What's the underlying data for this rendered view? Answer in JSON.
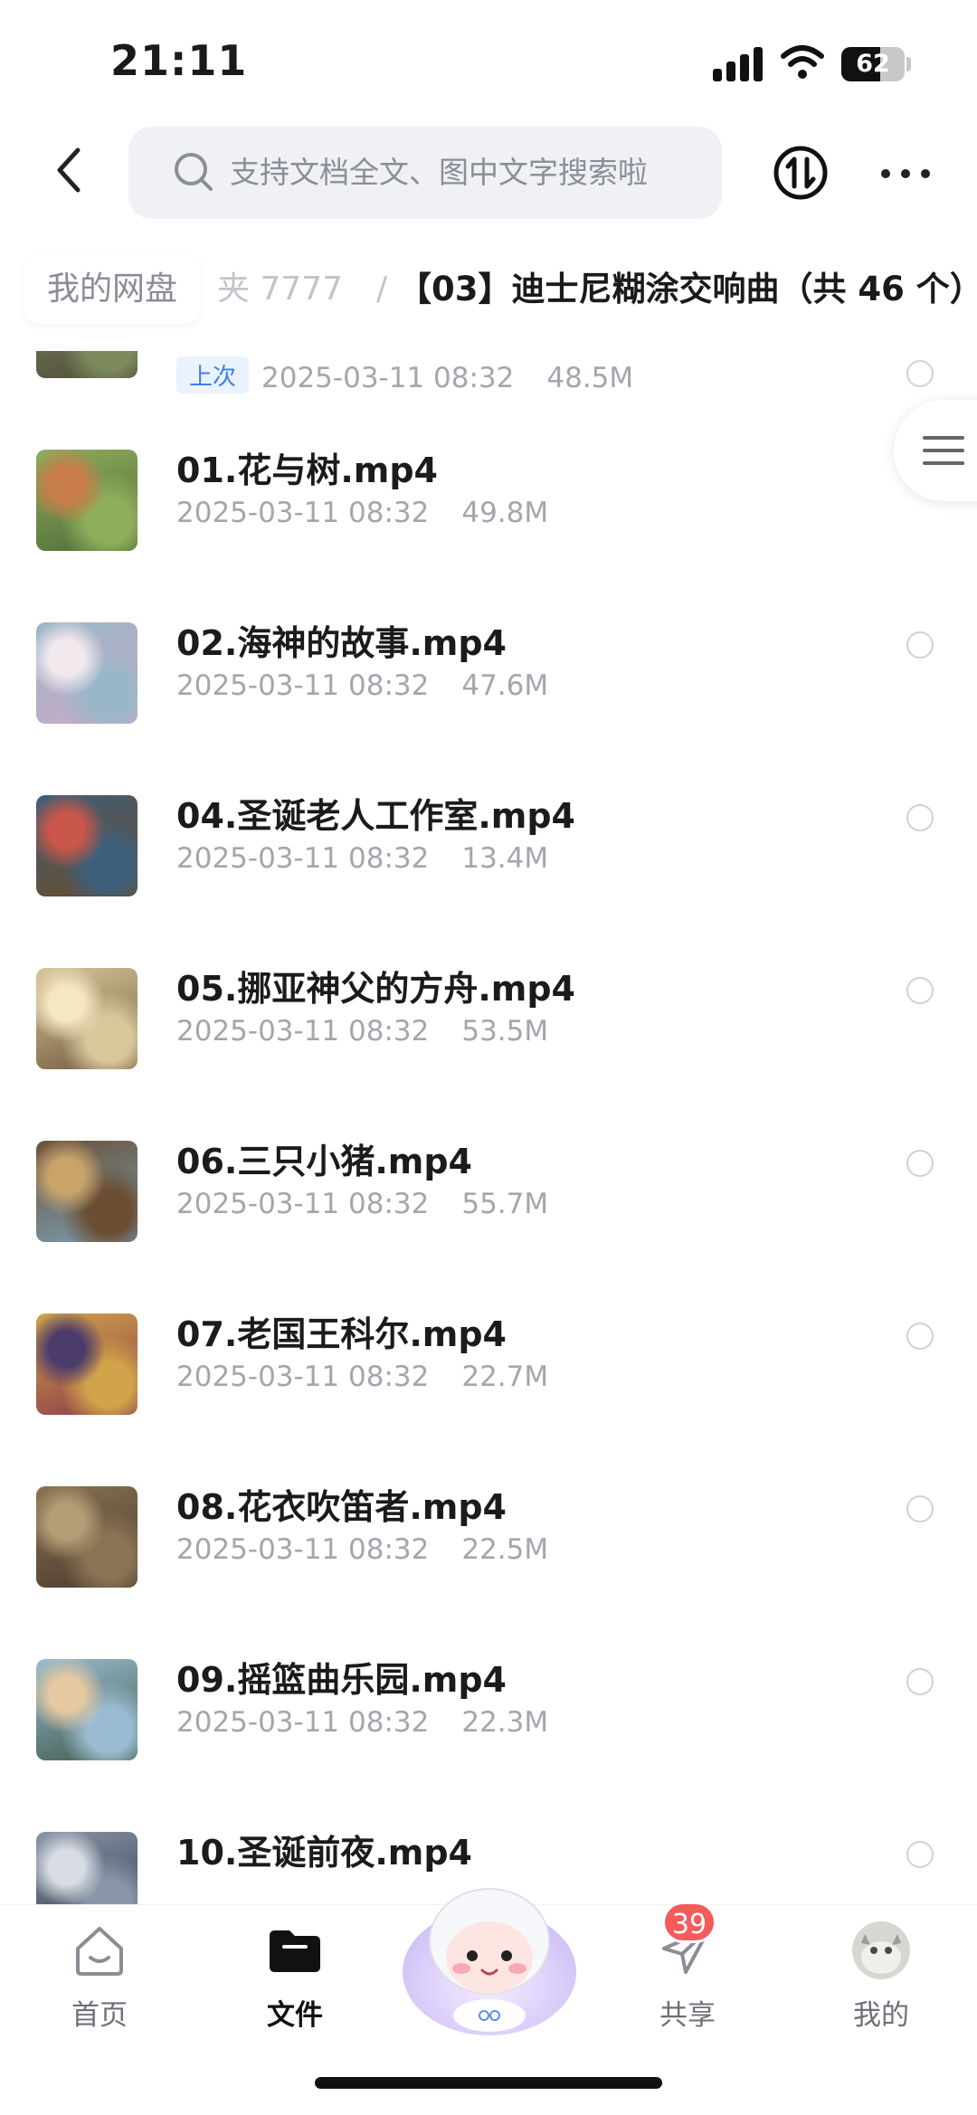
{
  "status_bar": {
    "time": "21:11",
    "battery": "62",
    "battery_level": 0.62
  },
  "header": {
    "search_placeholder": "支持文档全文、图中文字搜索啦",
    "icons": {
      "back": "chevron-left-icon",
      "search": "search-icon",
      "transfer": "transfer-icon",
      "more": "more-dots-icon"
    }
  },
  "breadcrumb": {
    "home": "我的网盘",
    "middle": "夹 7777",
    "separator": "/",
    "current": "【03】迪士尼糊涂交响曲（共 46 个）"
  },
  "files": [
    {
      "name": "",
      "date": "2025-03-11 08:32",
      "size": "48.5M",
      "tag": "上次",
      "thumb_colors": [
        "#4f4a3a",
        "#7c8a5c",
        "#c7b58a"
      ]
    },
    {
      "name": "01.花与树.mp4",
      "date": "2025-03-11 08:32",
      "size": "49.8M",
      "thumb_colors": [
        "#4e6a3a",
        "#8fae5b",
        "#c97d4a"
      ]
    },
    {
      "name": "02.海神的故事.mp4",
      "date": "2025-03-11 08:32",
      "size": "47.6M",
      "thumb_colors": [
        "#caa8c4",
        "#9ab7c9",
        "#f2e9ee"
      ]
    },
    {
      "name": "04.圣诞老人工作室.mp4",
      "date": "2025-03-11 08:32",
      "size": "13.4M",
      "thumb_colors": [
        "#6b4b2a",
        "#3e5f7a",
        "#c9574a"
      ]
    },
    {
      "name": "05.挪亚神父的方舟.mp4",
      "date": "2025-03-11 08:32",
      "size": "53.5M",
      "thumb_colors": [
        "#6f5a3d",
        "#d9c79b",
        "#f4e7c2"
      ]
    },
    {
      "name": "06.三只小猪.mp4",
      "date": "2025-03-11 08:32",
      "size": "55.7M",
      "thumb_colors": [
        "#7aa0b6",
        "#6b4f35",
        "#c9a46a"
      ]
    },
    {
      "name": "07.老国王科尔.mp4",
      "date": "2025-03-11 08:32",
      "size": "22.7M",
      "thumb_colors": [
        "#8a3b4b",
        "#d1a34a",
        "#4a3b6b"
      ]
    },
    {
      "name": "08.花衣吹笛者.mp4",
      "date": "2025-03-11 08:32",
      "size": "22.5M",
      "thumb_colors": [
        "#4a3b2d",
        "#8a7253",
        "#b59e76"
      ]
    },
    {
      "name": "09.摇篮曲乐园.mp4",
      "date": "2025-03-11 08:32",
      "size": "22.3M",
      "thumb_colors": [
        "#3e5a4a",
        "#9bbcd0",
        "#e4c9a1"
      ]
    },
    {
      "name": "10.圣诞前夜.mp4",
      "date": "",
      "size": "",
      "thumb_colors": [
        "#2f3a4a",
        "#8a96a8",
        "#d8dde4"
      ]
    }
  ],
  "tab_bar": {
    "tabs": [
      {
        "label": "首页",
        "icon": "home-icon"
      },
      {
        "label": "文件",
        "icon": "folder-icon"
      },
      {
        "label": "共享",
        "icon": "share-plane-icon",
        "badge": "39"
      },
      {
        "label": "我的",
        "icon": "avatar"
      }
    ],
    "active_index": 1
  }
}
